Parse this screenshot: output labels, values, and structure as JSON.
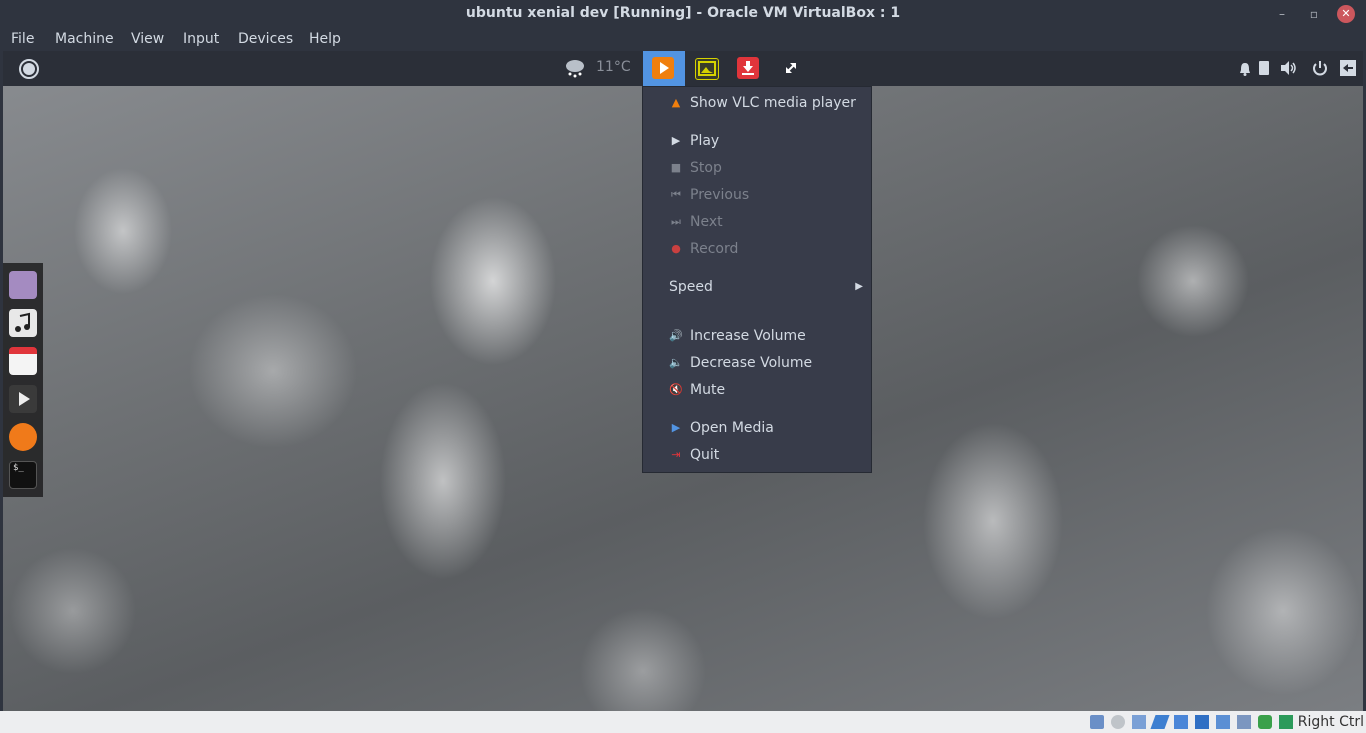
{
  "window": {
    "title": "ubuntu xenial dev [Running] - Oracle VM VirtualBox : 1"
  },
  "menubar": {
    "items": [
      "File",
      "Machine",
      "View",
      "Input",
      "Devices",
      "Help"
    ]
  },
  "panel": {
    "weather_icon": "cloud-snow-icon",
    "temperature": "11°C",
    "tray_icons": [
      "vlc-play-icon",
      "image-viewer-icon",
      "download-icon",
      "swap-arrows-icon"
    ],
    "right_icons": [
      "bell-icon",
      "clipboard-icon",
      "volume-icon",
      "power-icon",
      "exit-icon"
    ]
  },
  "launcher": {
    "items": [
      "files-icon",
      "music-icon",
      "calendar-icon",
      "video-player-icon",
      "firefox-icon",
      "terminal-icon"
    ]
  },
  "vlc_menu": {
    "show_player": "Show VLC media player",
    "play": "Play",
    "stop": "Stop",
    "previous": "Previous",
    "next": "Next",
    "record": "Record",
    "speed": "Speed",
    "increase_volume": "Increase Volume",
    "decrease_volume": "Decrease Volume",
    "mute": "Mute",
    "open_media": "Open Media",
    "quit": "Quit"
  },
  "statusbar": {
    "host_key": "Right Ctrl"
  },
  "colors": {
    "accent": "#5294e2",
    "vlc_orange": "#f07f0e",
    "panel": "#2b2f38",
    "menu_bg": "#383c4a"
  }
}
